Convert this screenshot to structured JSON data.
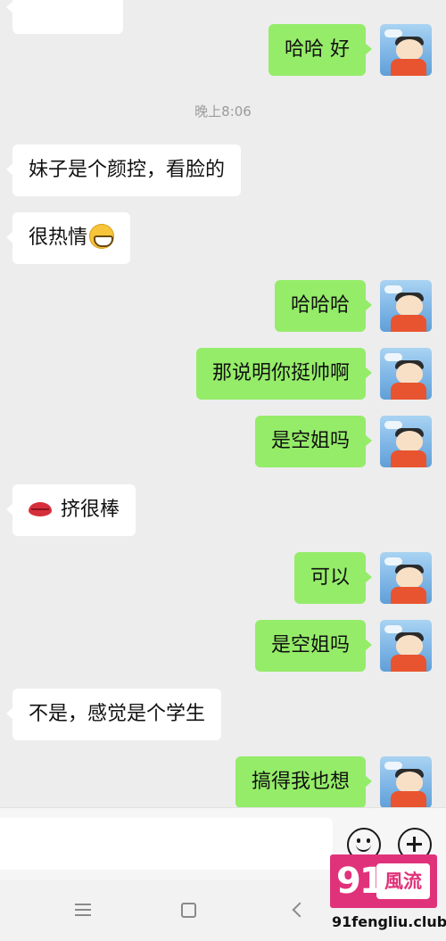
{
  "chat": {
    "time_divider": "晚上8:06",
    "messages": [
      {
        "side": "out",
        "text": "哈哈 好"
      },
      {
        "side": "in",
        "text": "妹子是个颜控，看脸的"
      },
      {
        "side": "in",
        "text": "很热情",
        "emoji": "grinning-face"
      },
      {
        "side": "out",
        "text": "哈哈哈"
      },
      {
        "side": "out",
        "text": "那说明你挺帅啊"
      },
      {
        "side": "out",
        "text": "是空姐吗"
      },
      {
        "side": "in",
        "text": "挤很棒",
        "emoji_prefix": "kiss-lips"
      },
      {
        "side": "out",
        "text": "可以"
      },
      {
        "side": "out",
        "text": "是空姐吗"
      },
      {
        "side": "in",
        "text": "不是，感觉是个学生"
      },
      {
        "side": "out",
        "text": "搞得我也想"
      }
    ]
  },
  "input_bar": {
    "value": "",
    "emoji_icon": "smiley-icon",
    "plus_icon": "plus-icon"
  },
  "nav_bar": {
    "icons": [
      "menu-icon",
      "home-square-icon",
      "back-icon"
    ]
  },
  "watermark": {
    "number": "91",
    "tag": "風流",
    "url": "91fengliu.club",
    "color": "#e0327a"
  },
  "colors": {
    "outgoing_bubble": "#95ec69",
    "incoming_bubble": "#ffffff",
    "background": "#ededed"
  }
}
